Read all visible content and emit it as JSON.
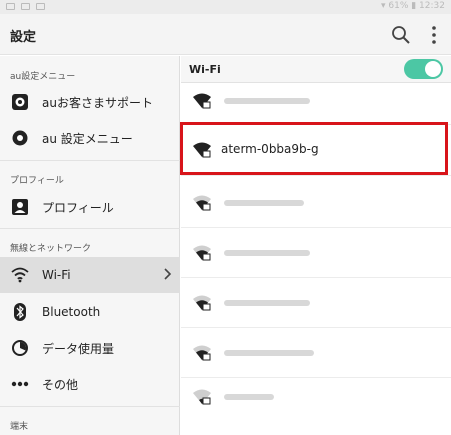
{
  "app": {
    "title": "設定"
  },
  "statusbar": {
    "right_text": "▾ 61% ▮ 12:32"
  },
  "sidebar": {
    "sections": [
      {
        "label": "au設定メニュー"
      },
      {
        "label": "プロフィール"
      },
      {
        "label": "無線とネットワーク"
      },
      {
        "label": "端末"
      }
    ],
    "items": [
      {
        "label": "auお客さまサポート",
        "icon": "support-icon"
      },
      {
        "label": "au 設定メニュー",
        "icon": "gear-icon"
      },
      {
        "label": "プロフィール",
        "icon": "profile-icon"
      },
      {
        "label": "Wi-Fi",
        "icon": "wifi-icon",
        "selected": true
      },
      {
        "label": "Bluetooth",
        "icon": "bluetooth-icon"
      },
      {
        "label": "データ使用量",
        "icon": "data-usage-icon"
      },
      {
        "label": "その他",
        "icon": "more-icon"
      }
    ]
  },
  "wifi": {
    "header": "Wi-Fi",
    "enabled": true,
    "networks": [
      {
        "name": ""
      },
      {
        "name": "aterm-0bba9b-g"
      },
      {
        "name": ""
      },
      {
        "name": ""
      },
      {
        "name": ""
      },
      {
        "name": ""
      },
      {
        "name": ""
      }
    ]
  },
  "colors": {
    "toggle_on": "#4cc7a4",
    "highlight": "#d8141a"
  }
}
